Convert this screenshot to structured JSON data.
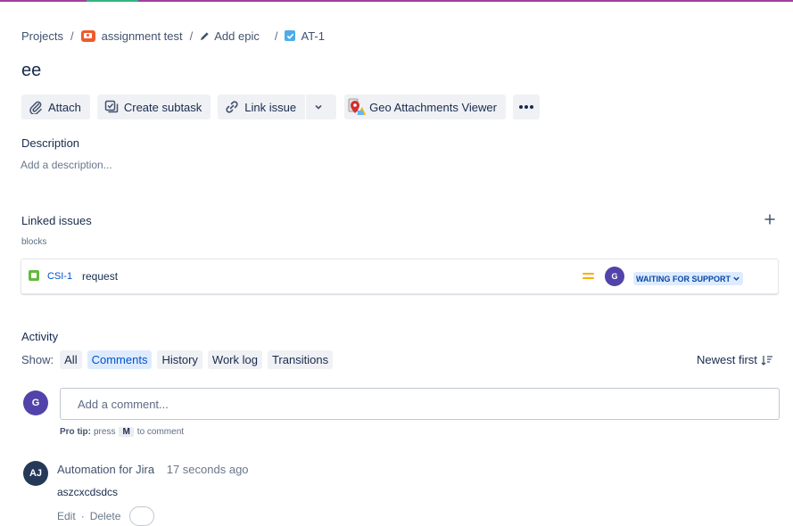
{
  "breadcrumbs": {
    "projects": "Projects",
    "project": "assignment test",
    "epic": "Add epic",
    "issue_key": "AT-1"
  },
  "issue": {
    "title": "ee"
  },
  "toolbar": {
    "attach": "Attach",
    "create_subtask": "Create subtask",
    "link_issue": "Link issue",
    "geo_viewer": "Geo Attachments Viewer"
  },
  "description": {
    "heading": "Description",
    "placeholder": "Add a description..."
  },
  "linked_issues": {
    "heading": "Linked issues",
    "relation": "blocks",
    "items": [
      {
        "key": "CSI-1",
        "summary": "request",
        "priority": "medium",
        "assignee_initial": "G",
        "status": "WAITING FOR SUPPORT"
      }
    ]
  },
  "activity": {
    "heading": "Activity",
    "show_label": "Show:",
    "tabs": [
      "All",
      "Comments",
      "History",
      "Work log",
      "Transitions"
    ],
    "active_tab": "Comments",
    "sort": "Newest first",
    "user_initial": "G",
    "comment_placeholder": "Add a comment...",
    "protip_label": "Pro tip:",
    "protip_press": "press",
    "protip_key": "M",
    "protip_rest": "to comment"
  },
  "comments": [
    {
      "initials": "AJ",
      "author": "Automation for Jira",
      "time": "17 seconds ago",
      "body": "aszcxcdsdcs",
      "edit": "Edit",
      "delete": "Delete"
    }
  ],
  "colors": {
    "accent": "#0052cc",
    "user_avatar": "#5243aa",
    "automation_avatar": "#253858",
    "status_bg": "#deebff"
  }
}
